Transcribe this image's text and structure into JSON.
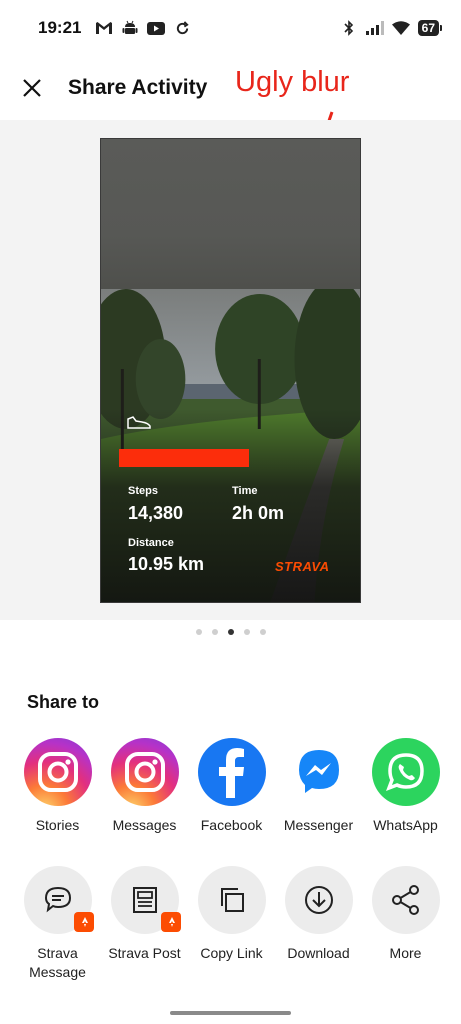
{
  "status_bar": {
    "time": "19:21",
    "battery": "67"
  },
  "header": {
    "title": "Share Activity"
  },
  "annotation": {
    "text": "Ugly blur",
    "color": "#e8261b"
  },
  "activity_card": {
    "stats": {
      "steps_label": "Steps",
      "steps_value": "14,380",
      "time_label": "Time",
      "time_value": "2h 0m",
      "distance_label": "Distance",
      "distance_value": "10.95 km"
    },
    "brand": "STRAVA",
    "brand_color": "#fc4c02",
    "redaction_color": "#fc2d0b"
  },
  "pager": {
    "count": 5,
    "active_index": 2
  },
  "share": {
    "title": "Share to",
    "row1": [
      {
        "label": "Stories",
        "icon": "instagram-icon"
      },
      {
        "label": "Messages",
        "icon": "instagram-icon"
      },
      {
        "label": "Facebook",
        "icon": "facebook-icon"
      },
      {
        "label": "Messenger",
        "icon": "messenger-icon"
      },
      {
        "label": "WhatsApp",
        "icon": "whatsapp-icon"
      }
    ],
    "row2": [
      {
        "label": "Strava Message",
        "icon": "chat-bubble-icon"
      },
      {
        "label": "Strava Post",
        "icon": "post-icon"
      },
      {
        "label": "Copy Link",
        "icon": "copy-icon"
      },
      {
        "label": "Download",
        "icon": "download-icon"
      },
      {
        "label": "More",
        "icon": "share-icon"
      }
    ]
  }
}
